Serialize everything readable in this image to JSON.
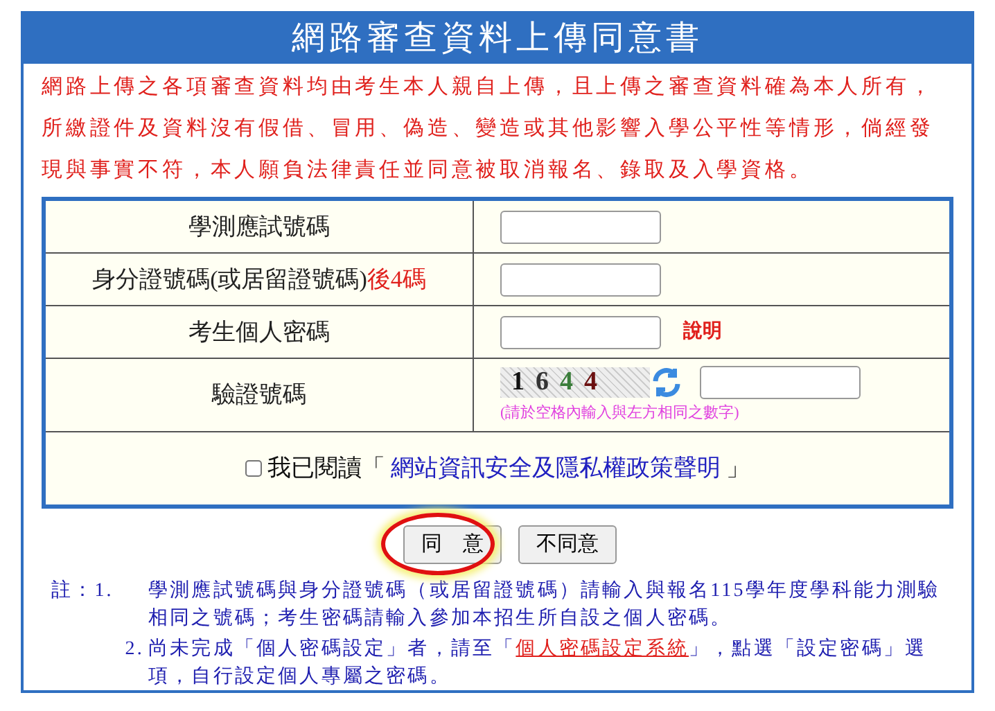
{
  "title": "網路審查資料上傳同意書",
  "intro": "網路上傳之各項審查資料均由考生本人親自上傳，且上傳之審查資料確為本人所有，所繳證件及資料沒有假借、冒用、偽造、變造或其他影響入學公平性等情形，倘經發現與事實不符，本人願負法律責任並同意被取消報名、錄取及入學資格。",
  "form": {
    "rows": [
      {
        "kind": "input",
        "label": "學測應試號碼"
      },
      {
        "kind": "input",
        "label": "身分證號碼(或居留證號碼)",
        "label_suffix": "後4碼"
      },
      {
        "kind": "input",
        "label": "考生個人密碼",
        "link": "說明"
      },
      {
        "kind": "captcha",
        "label": "驗證號碼",
        "captcha": [
          {
            "text": "1",
            "color": "#111111"
          },
          {
            "text": "6",
            "color": "#333333"
          },
          {
            "text": "4",
            "color": "#3a7d3a"
          },
          {
            "text": "4",
            "color": "#6b1010"
          }
        ],
        "hint": "(請於空格內輸入與左方相同之數字)"
      }
    ],
    "agreement": {
      "checked": false,
      "label": "我已閱讀「",
      "link": "網站資訊安全及隱私權政策聲明",
      "label_end": "」"
    }
  },
  "buttons": [
    {
      "label": "同　意",
      "highlighted": true
    },
    {
      "label": "不同意",
      "highlighted": false
    }
  ],
  "notes": [
    {
      "prefix": "註：1.",
      "parts": [
        {
          "kind": "text",
          "text": "學測應試號碼與身分證號碼（或居留證號碼）請輸入與報名115學年度學科能力測驗相同之號碼；考生密碼請輸入參加本招生所自設之個人密碼。"
        }
      ]
    },
    {
      "prefix": "2.",
      "parts": [
        {
          "kind": "text",
          "text": "尚未完成「個人密碼設定」者，請至「"
        },
        {
          "kind": "link",
          "text": "個人密碼設定系統"
        },
        {
          "kind": "text",
          "text": "」，點選「設定密碼」選項，自行設定個人專屬之密碼。"
        }
      ]
    }
  ]
}
